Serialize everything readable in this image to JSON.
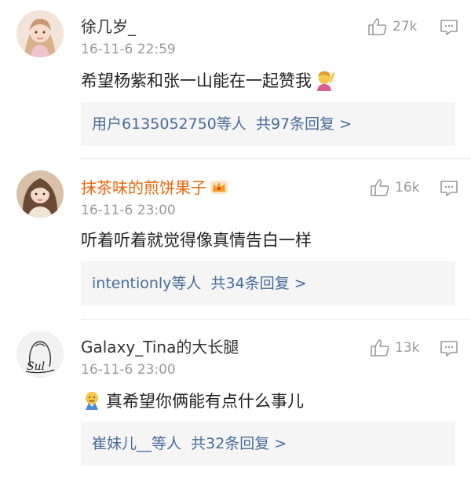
{
  "comments": [
    {
      "username": "徐几岁_",
      "time": "16-11-6 22:59",
      "likes": "27k",
      "text": "希望杨紫和张一山能在一起赞我",
      "emoji": "woman-raising-hand-emoji",
      "reply_users": "用户6135052750等人",
      "reply_count": "共97条回复 >"
    },
    {
      "username": "抹茶味的煎饼果子",
      "time": "16-11-6 23:00",
      "likes": "16k",
      "text": "听着听着就觉得像真情告白一样",
      "badge": "vip-crown-icon",
      "reply_users": "intentionly等人",
      "reply_count": "共34条回复 >"
    },
    {
      "username": "Galaxy_Tina的大长腿",
      "time": "16-11-6 23:00",
      "likes": "13k",
      "text": "真希望你俩能有点什么事儿",
      "emoji": "praying-emoji",
      "reply_users": "崔妹儿__等人",
      "reply_count": "共32条回复 >"
    }
  ],
  "colors": {
    "link": "#4a6b9a",
    "vip_name": "#e8660c",
    "meta": "#9a9a9a",
    "reply_bg": "#f5f5f5"
  }
}
